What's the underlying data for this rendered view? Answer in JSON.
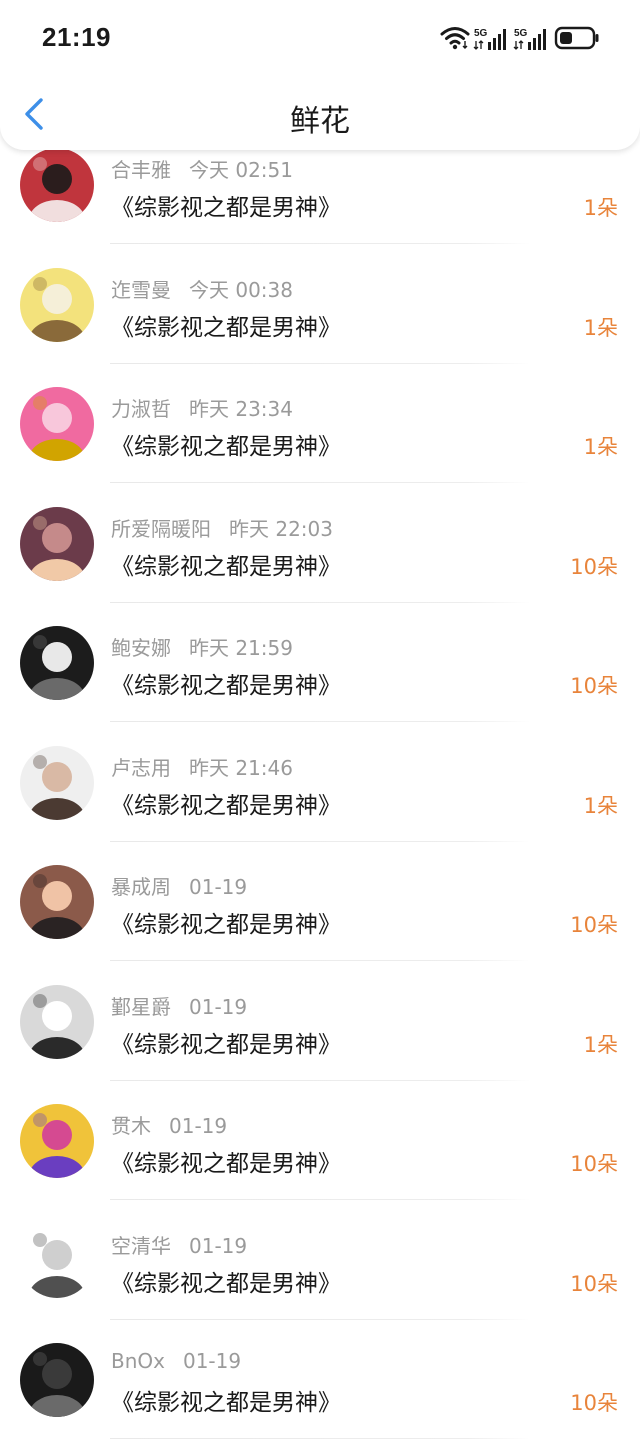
{
  "status": {
    "time": "21:19",
    "network1": "5G",
    "network2": "5G"
  },
  "header": {
    "title": "鲜花"
  },
  "colors": {
    "accent": "#3d8fe8",
    "flower_count": "#e8843b",
    "secondary_text": "#9a9a9a"
  },
  "items": [
    {
      "name": "合丰雅",
      "time": "今天 02:51",
      "book": "《综影视之都是男神》",
      "flowers": "1朵",
      "avatar": [
        "#c0353d",
        "#2b1d1d",
        "#f1dede"
      ]
    },
    {
      "name": "迮雪曼",
      "time": "今天 00:38",
      "book": "《综影视之都是男神》",
      "flowers": "1朵",
      "avatar": [
        "#f3e27c",
        "#f5efd8",
        "#8a6a3a"
      ]
    },
    {
      "name": "力淑哲",
      "time": "昨天 23:34",
      "book": "《综影视之都是男神》",
      "flowers": "1朵",
      "avatar": [
        "#f06aa0",
        "#f8c7db",
        "#d1a400"
      ]
    },
    {
      "name": "所爱隔暖阳",
      "time": "昨天 22:03",
      "book": "《综影视之都是男神》",
      "flowers": "10朵",
      "avatar": [
        "#6b3b4a",
        "#c58a8a",
        "#f1c9a7"
      ]
    },
    {
      "name": "鲍安娜",
      "time": "昨天 21:59",
      "book": "《综影视之都是男神》",
      "flowers": "10朵",
      "avatar": [
        "#1c1c1c",
        "#e8e8e8",
        "#6a6a6a"
      ]
    },
    {
      "name": "卢志用",
      "time": "昨天 21:46",
      "book": "《综影视之都是男神》",
      "flowers": "1朵",
      "avatar": [
        "#efefef",
        "#d9b9a5",
        "#4b3a32"
      ]
    },
    {
      "name": "暴成周",
      "time": "01-19",
      "book": "《综影视之都是男神》",
      "flowers": "10朵",
      "avatar": [
        "#8b5a4a",
        "#f0c3a6",
        "#2a2323"
      ]
    },
    {
      "name": "鄞星爵",
      "time": "01-19",
      "book": "《综影视之都是男神》",
      "flowers": "1朵",
      "avatar": [
        "#d9d9d9",
        "#ffffff",
        "#2a2a2a"
      ]
    },
    {
      "name": "贯木",
      "time": "01-19",
      "book": "《综影视之都是男神》",
      "flowers": "10朵",
      "avatar": [
        "#f0c33a",
        "#d54a91",
        "#6a3ec0"
      ]
    },
    {
      "name": "空清华",
      "time": "01-19",
      "book": "《综影视之都是男神》",
      "flowers": "10朵",
      "avatar": [
        "#ffffff",
        "#cfcfcf",
        "#505050"
      ]
    },
    {
      "name": "BnOx",
      "time": "01-19",
      "book": "《综影视之都是男神》",
      "flowers": "10朵",
      "avatar": [
        "#1a1a1a",
        "#3a3a3a",
        "#6a6a6a"
      ]
    }
  ]
}
